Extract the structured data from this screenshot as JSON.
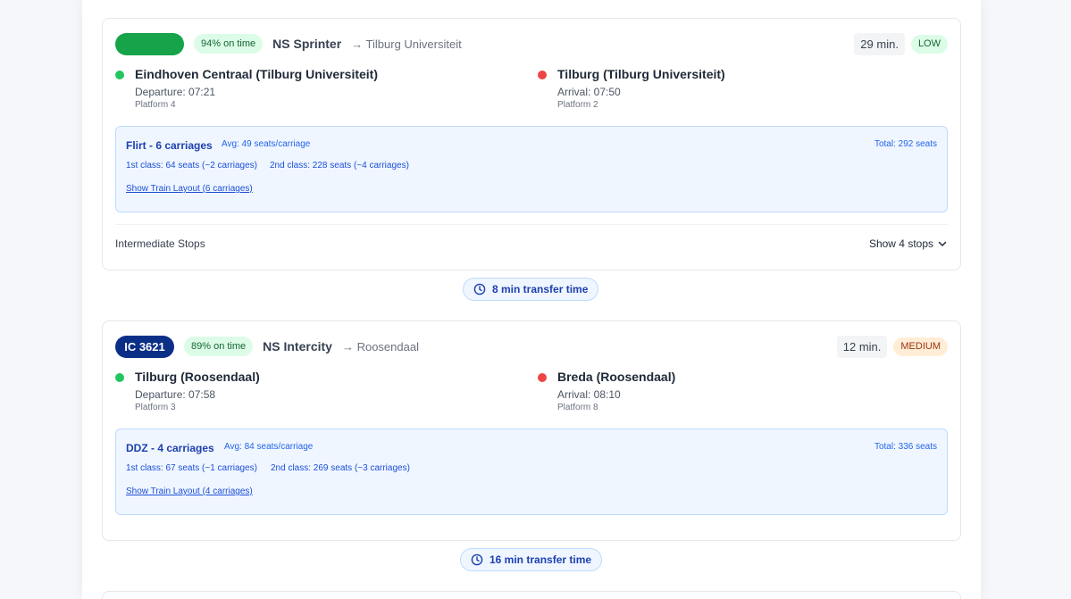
{
  "legs": [
    {
      "train_label": "",
      "on_time": "94% on time",
      "operator": "NS Sprinter",
      "destination": "→ Tilburg Universiteit",
      "duration": "29 min.",
      "crowding": "LOW",
      "departure": {
        "station": "Eindhoven Centraal (Tilburg Universiteit)",
        "time": "Departure: 07:21",
        "platform": "Platform 4"
      },
      "arrival": {
        "station": "Tilburg (Tilburg Universiteit)",
        "time": "Arrival: 07:50",
        "platform": "Platform 2"
      },
      "capacity": {
        "type": "Flirt - 6 carriages",
        "avg": "Avg: 49 seats/carriage",
        "total": "Total: 292 seats",
        "first_class": "1st class: 64 seats (~2 carriages)",
        "second_class": "2nd class: 228 seats (~4 carriages)",
        "layout_link": "Show Train Layout (6 carriages)"
      },
      "intermediate_label": "Intermediate Stops",
      "intermediate_toggle": "Show 4 stops"
    },
    {
      "train_label": "IC 3621",
      "on_time": "89% on time",
      "operator": "NS Intercity",
      "destination": "→ Roosendaal",
      "duration": "12 min.",
      "crowding": "MEDIUM",
      "departure": {
        "station": "Tilburg (Roosendaal)",
        "time": "Departure: 07:58",
        "platform": "Platform 3"
      },
      "arrival": {
        "station": "Breda (Roosendaal)",
        "time": "Arrival: 08:10",
        "platform": "Platform 8"
      },
      "capacity": {
        "type": "DDZ - 4 carriages",
        "avg": "Avg: 84 seats/carriage",
        "total": "Total: 336 seats",
        "first_class": "1st class: 67 seats (~1 carriages)",
        "second_class": "2nd class: 269 seats (~3 carriages)",
        "layout_link": "Show Train Layout (4 carriages)"
      }
    }
  ],
  "transfers": [
    "8 min transfer time",
    "16 min transfer time"
  ],
  "colors": {
    "sprinter": "#16a34a",
    "intercity": "#0b2f87",
    "departure_dot": "#22c55e",
    "arrival_dot": "#ef4444",
    "accent": "#1e40af"
  },
  "icons": {
    "transfer": "clock-icon",
    "toggle": "chevron-down-icon"
  }
}
